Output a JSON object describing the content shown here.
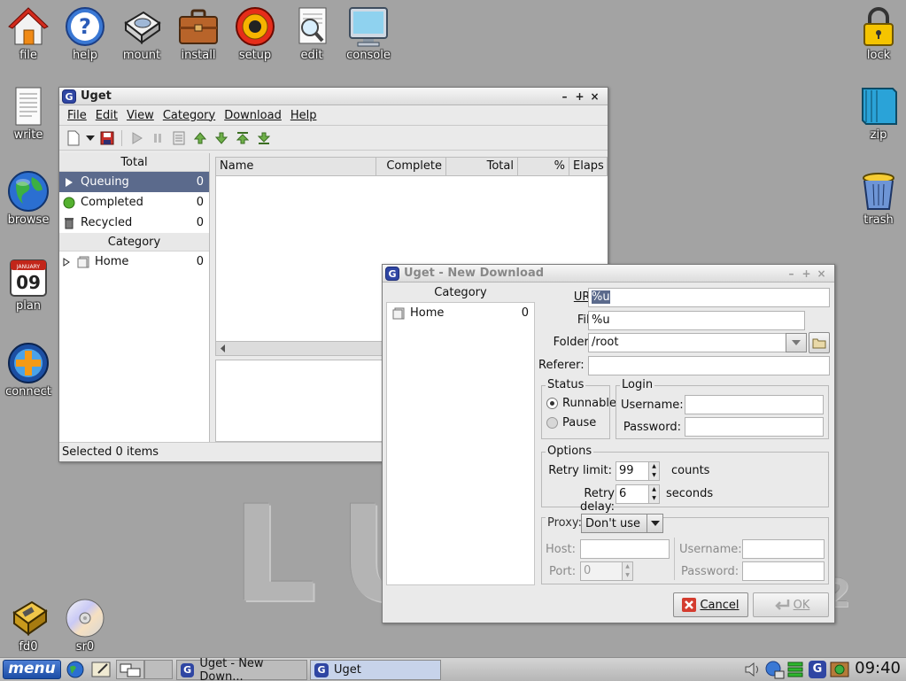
{
  "desktop": {
    "icons": {
      "file": "file",
      "help": "help",
      "mount": "mount",
      "install": "install",
      "setup": "setup",
      "edit": "edit",
      "console": "console",
      "lock": "lock",
      "write": "write",
      "zip": "zip",
      "browse": "browse",
      "trash": "trash",
      "plan": "plan",
      "connect": "connect",
      "fd0": "fd0",
      "sr0": "sr0"
    },
    "calendar": {
      "month": "JANUARY",
      "day": "09"
    },
    "watermark": {
      "text": "LU",
      "mark": "2"
    }
  },
  "uget": {
    "title": "Uget",
    "menu": [
      "File",
      "Edit",
      "View",
      "Category",
      "Download",
      "Help"
    ],
    "total_header": "Total",
    "category_header": "Category",
    "states": [
      {
        "label": "Queuing",
        "count": "0"
      },
      {
        "label": "Completed",
        "count": "0"
      },
      {
        "label": "Recycled",
        "count": "0"
      }
    ],
    "categories": [
      {
        "label": "Home",
        "count": "0"
      }
    ],
    "columns": [
      "Name",
      "Complete",
      "Total",
      "%",
      "Elaps"
    ],
    "status": "Selected 0 items"
  },
  "dialog": {
    "title": "Uget - New Download",
    "category_header": "Category",
    "categories": [
      {
        "label": "Home",
        "count": "0"
      }
    ],
    "url_label": "URL:",
    "url_value": "%u",
    "file_label": "File:",
    "file_value": "%u",
    "folder_label": "Folder:",
    "folder_value": "/root",
    "referer_label": "Referer:",
    "referer_value": "",
    "status_label": "Status",
    "runnable_label": "Runnable",
    "pause_label": "Pause",
    "login_label": "Login",
    "username_label": "Username:",
    "password_label": "Password:",
    "options_label": "Options",
    "retry_limit_label": "Retry limit:",
    "retry_limit_value": "99",
    "retry_limit_unit": "counts",
    "retry_delay_label": "Retry delay:",
    "retry_delay_value": "6",
    "retry_delay_unit": "seconds",
    "proxy_label": "Proxy:",
    "proxy_value": "Don't use",
    "host_label": "Host:",
    "port_label": "Port:",
    "port_value": "0",
    "proxy_username_label": "Username:",
    "proxy_password_label": "Password:",
    "cancel_label": "Cancel",
    "ok_label": "OK"
  },
  "taskbar": {
    "menu_label": "menu",
    "tasks": [
      "Uget - New Down...",
      "Uget"
    ],
    "clock": "09:40"
  },
  "colors": {
    "desktop": "#a3a3a3",
    "selection": "#5b6a8c",
    "uget_icon": "#2f46a3",
    "taskbar_active": "#c7d3ea"
  }
}
